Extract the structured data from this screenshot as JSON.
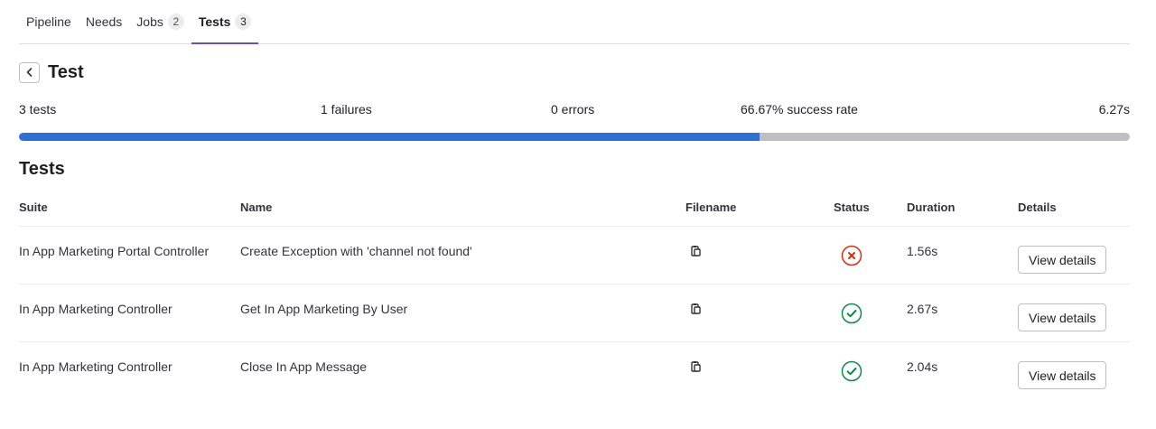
{
  "tabs": [
    {
      "label": "Pipeline",
      "count": ""
    },
    {
      "label": "Needs",
      "count": ""
    },
    {
      "label": "Jobs",
      "count": "2"
    },
    {
      "label": "Tests",
      "count": "3"
    }
  ],
  "header": {
    "title": "Test"
  },
  "summary": {
    "tests": "3 tests",
    "failures": "1 failures",
    "errors": "0 errors",
    "success_rate": "66.67% success rate",
    "duration": "6.27s",
    "success_fraction": 0.6667
  },
  "section_title": "Tests",
  "table": {
    "headers": {
      "suite": "Suite",
      "name": "Name",
      "filename": "Filename",
      "status": "Status",
      "duration": "Duration",
      "details": "Details"
    },
    "rows": [
      {
        "suite": "In App Marketing Portal Controller",
        "name": "Create Exception with 'channel not found'",
        "status": "failed",
        "duration": "1.56s",
        "details_label": "View details"
      },
      {
        "suite": "In App Marketing Controller",
        "name": "Get In App Marketing By User",
        "status": "success",
        "duration": "2.67s",
        "details_label": "View details"
      },
      {
        "suite": "In App Marketing Controller",
        "name": "Close In App Message",
        "status": "success",
        "duration": "2.04s",
        "details_label": "View details"
      }
    ]
  },
  "colors": {
    "accent": "#6b4fbb",
    "progress": "#2f6fd3",
    "failed": "#dd2b0e",
    "success": "#108548"
  }
}
